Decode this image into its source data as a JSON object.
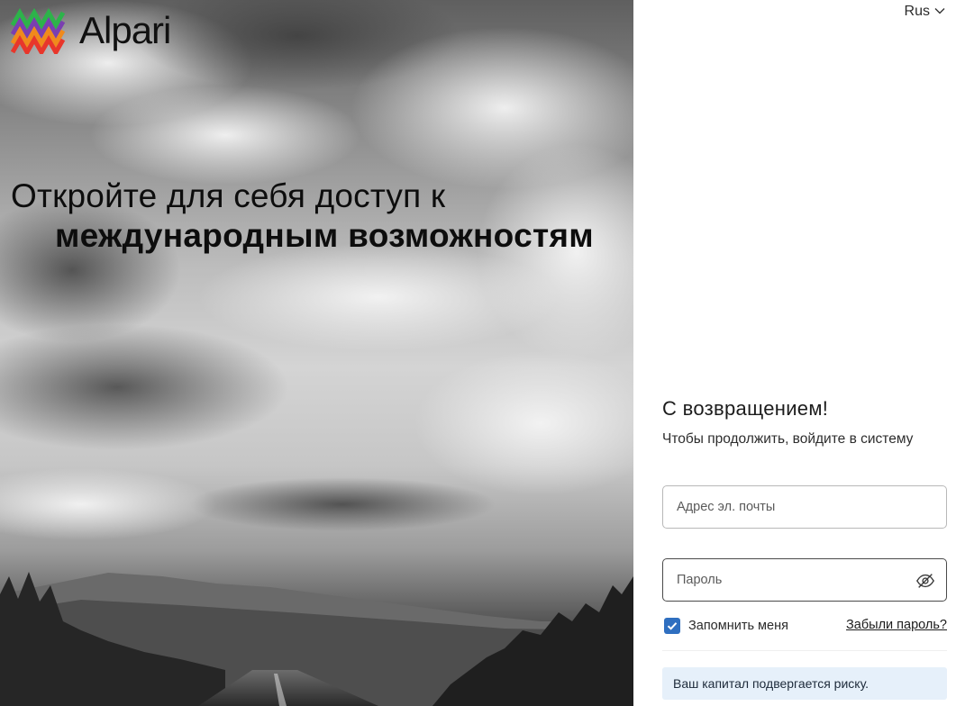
{
  "brand": {
    "name": "Alpari"
  },
  "hero": {
    "headline_line1": "Откройте для себя доступ к",
    "headline_line2": "международным возможностям"
  },
  "language": {
    "selected": "Rus",
    "icon": "chevron-down-icon"
  },
  "login": {
    "title": "С возвращением!",
    "subtitle": "Чтобы продолжить, войдите в систему",
    "email_placeholder": "Адрес эл. почты",
    "password_placeholder": "Пароль",
    "password_toggle_icon": "eye-off-icon",
    "remember_label": "Запомнить меня",
    "remember_checked": true,
    "forgot_label": "Забыли пароль?",
    "risk_notice": "Ваш капитал подвергается риску."
  },
  "colors": {
    "checkbox": "#2f6fc0",
    "risk_notice_bg": "#e6f0fa",
    "logo_green": "#2db34a",
    "logo_purple": "#7a3fb0",
    "logo_orange": "#f08a1c",
    "logo_red": "#e8362b"
  }
}
